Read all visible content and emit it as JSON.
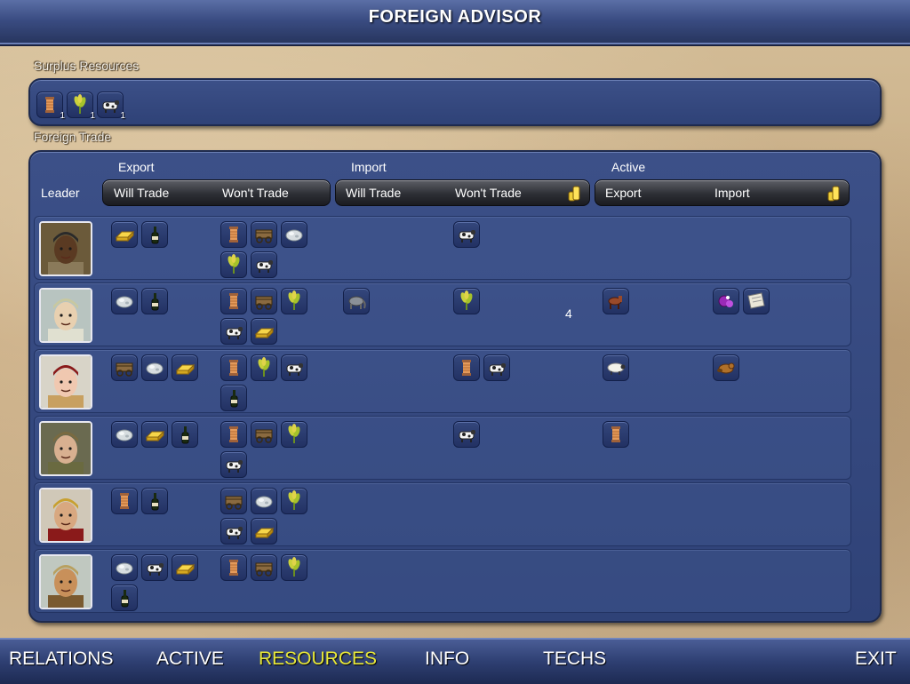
{
  "title": "FOREIGN ADVISOR",
  "surplus_label": "Surplus Resources",
  "surplus_items": [
    {
      "icon": "spool-icon",
      "qty": "1"
    },
    {
      "icon": "wheat-icon",
      "qty": "1"
    },
    {
      "icon": "cattle-icon",
      "qty": "1"
    }
  ],
  "trade_label": "Foreign Trade",
  "headers": {
    "export": "Export",
    "import": "Import",
    "active": "Active",
    "leader": "Leader",
    "will_trade": "Will Trade",
    "wont_trade": "Won't Trade",
    "active_export": "Export",
    "active_import": "Import"
  },
  "rows": [
    {
      "leader": "leader-1",
      "export_will": [
        "gold-icon",
        "wine-icon"
      ],
      "export_wont": [
        "spool-icon",
        "wagon-icon",
        "ore-icon",
        "wheat-icon",
        "cattle-icon"
      ],
      "import_will": [],
      "import_wont": [
        "cattle-icon"
      ],
      "gold": "",
      "active_export": [],
      "active_import": []
    },
    {
      "leader": "leader-2",
      "export_will": [
        "ore-icon",
        "wine-icon"
      ],
      "export_wont": [
        "spool-icon",
        "wagon-icon",
        "wheat-icon",
        "cattle-icon",
        "gold-icon"
      ],
      "import_will": [
        "elephant-icon"
      ],
      "import_wont": [
        "wheat-icon"
      ],
      "gold": "4",
      "active_export": [
        "horse-icon"
      ],
      "active_import": [
        "dye-icon",
        "paper-icon"
      ]
    },
    {
      "leader": "leader-3",
      "export_will": [
        "wagon-icon",
        "ore-icon",
        "gold-icon"
      ],
      "export_wont": [
        "spool-icon",
        "wheat-icon",
        "cattle-icon",
        "wine-icon"
      ],
      "import_will": [],
      "import_wont": [
        "spool-icon",
        "cattle-icon"
      ],
      "gold": "",
      "active_export": [
        "sheep-icon"
      ],
      "active_import": [
        "beaver-icon"
      ]
    },
    {
      "leader": "leader-4",
      "export_will": [
        "ore-icon",
        "gold-icon",
        "wine-icon"
      ],
      "export_wont": [
        "spool-icon",
        "wagon-icon",
        "wheat-icon",
        "cattle-icon"
      ],
      "import_will": [],
      "import_wont": [
        "cattle-icon"
      ],
      "gold": "",
      "active_export": [
        "spool-icon"
      ],
      "active_import": []
    },
    {
      "leader": "leader-5",
      "export_will": [
        "spool-icon",
        "wine-icon"
      ],
      "export_wont": [
        "wagon-icon",
        "ore-icon",
        "wheat-icon",
        "cattle-icon",
        "gold-icon"
      ],
      "import_will": [],
      "import_wont": [],
      "gold": "",
      "active_export": [],
      "active_import": []
    },
    {
      "leader": "leader-6",
      "export_will": [
        "ore-icon",
        "cattle-icon",
        "gold-icon",
        "wine-icon"
      ],
      "export_wont": [
        "spool-icon",
        "wagon-icon",
        "wheat-icon"
      ],
      "import_will": [],
      "import_wont": [],
      "gold": "",
      "active_export": [],
      "active_import": []
    }
  ],
  "nav": [
    {
      "label": "RELATIONS",
      "active": false
    },
    {
      "label": "ACTIVE",
      "active": false
    },
    {
      "label": "RESOURCES",
      "active": true
    },
    {
      "label": "INFO",
      "active": false
    },
    {
      "label": "TECHS",
      "active": false
    },
    {
      "label": "EXIT",
      "active": false
    }
  ],
  "colors": {
    "panel": "#34497f",
    "active_tab": "#e8e83a",
    "parchment": "#c9b08a"
  }
}
